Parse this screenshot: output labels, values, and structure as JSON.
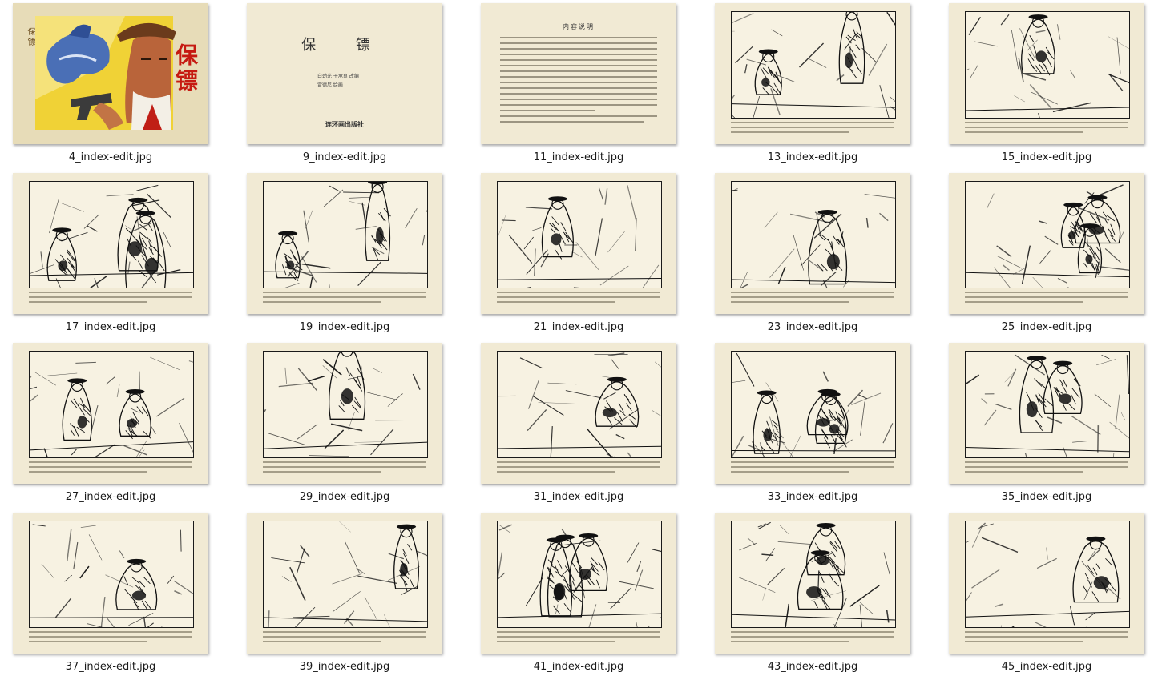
{
  "window": {
    "view": "thumbnail-grid"
  },
  "cover": {
    "title": "保镖",
    "side_text": "保 镖"
  },
  "title_page": {
    "title": "保 镖",
    "credits": [
      "白劲光 于承良 改编",
      "雷德尼 绘画"
    ],
    "publisher": "连环画出版社"
  },
  "intro_page": {
    "title": "内容说明"
  },
  "files": [
    {
      "name": "4_index-edit.jpg",
      "kind": "cover",
      "selected": false
    },
    {
      "name": "9_index-edit.jpg",
      "kind": "title",
      "selected": false
    },
    {
      "name": "11_index-edit.jpg",
      "kind": "intro",
      "selected": false
    },
    {
      "name": "13_index-edit.jpg",
      "kind": "panel",
      "selected": false
    },
    {
      "name": "15_index-edit.jpg",
      "kind": "panel",
      "selected": false
    },
    {
      "name": "17_index-edit.jpg",
      "kind": "panel",
      "selected": false
    },
    {
      "name": "19_index-edit.jpg",
      "kind": "panel",
      "selected": false
    },
    {
      "name": "21_index-edit.jpg",
      "kind": "panel",
      "selected": false
    },
    {
      "name": "23_index-edit.jpg",
      "kind": "panel",
      "selected": false
    },
    {
      "name": "25_index-edit.jpg",
      "kind": "panel",
      "selected": false
    },
    {
      "name": "27_index-edit.jpg",
      "kind": "panel",
      "selected": false
    },
    {
      "name": "29_index-edit.jpg",
      "kind": "panel",
      "selected": false
    },
    {
      "name": "31_index-edit.jpg",
      "kind": "panel",
      "selected": false
    },
    {
      "name": "33_index-edit.jpg",
      "kind": "panel",
      "selected": false
    },
    {
      "name": "35_index-edit.jpg",
      "kind": "panel",
      "selected": false
    },
    {
      "name": "37_index-edit.jpg",
      "kind": "panel",
      "selected": false
    },
    {
      "name": "39_index-edit.jpg",
      "kind": "panel",
      "selected": false
    },
    {
      "name": "41_index-edit.jpg",
      "kind": "panel",
      "selected": false
    },
    {
      "name": "43_index-edit.jpg",
      "kind": "panel",
      "selected": false
    },
    {
      "name": "45_index-edit.jpg",
      "kind": "panel",
      "selected": false
    }
  ],
  "colors": {
    "page_bg": "#ffffff",
    "paper": "#f1ead4",
    "ink": "#1a1a1a",
    "cover_red": "#c61a12",
    "cover_yellow": "#f0d236",
    "cover_blue": "#4a6fb6"
  }
}
